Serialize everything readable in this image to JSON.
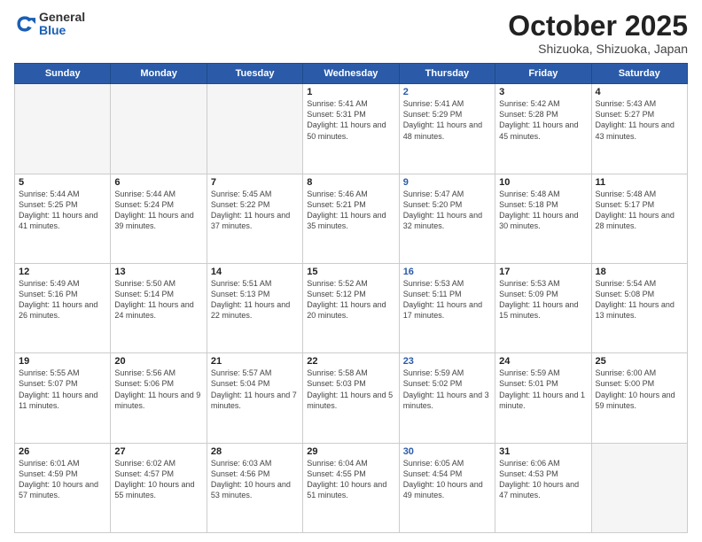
{
  "header": {
    "logo_general": "General",
    "logo_blue": "Blue",
    "month_title": "October 2025",
    "location": "Shizuoka, Shizuoka, Japan"
  },
  "weekdays": [
    "Sunday",
    "Monday",
    "Tuesday",
    "Wednesday",
    "Thursday",
    "Friday",
    "Saturday"
  ],
  "weeks": [
    [
      {
        "day": "",
        "sunrise": "",
        "sunset": "",
        "daylight": "",
        "empty": true
      },
      {
        "day": "",
        "sunrise": "",
        "sunset": "",
        "daylight": "",
        "empty": true
      },
      {
        "day": "",
        "sunrise": "",
        "sunset": "",
        "daylight": "",
        "empty": true
      },
      {
        "day": "1",
        "sunrise": "Sunrise: 5:41 AM",
        "sunset": "Sunset: 5:31 PM",
        "daylight": "Daylight: 11 hours and 50 minutes.",
        "empty": false
      },
      {
        "day": "2",
        "sunrise": "Sunrise: 5:41 AM",
        "sunset": "Sunset: 5:29 PM",
        "daylight": "Daylight: 11 hours and 48 minutes.",
        "empty": false,
        "thursday": true
      },
      {
        "day": "3",
        "sunrise": "Sunrise: 5:42 AM",
        "sunset": "Sunset: 5:28 PM",
        "daylight": "Daylight: 11 hours and 45 minutes.",
        "empty": false
      },
      {
        "day": "4",
        "sunrise": "Sunrise: 5:43 AM",
        "sunset": "Sunset: 5:27 PM",
        "daylight": "Daylight: 11 hours and 43 minutes.",
        "empty": false
      }
    ],
    [
      {
        "day": "5",
        "sunrise": "Sunrise: 5:44 AM",
        "sunset": "Sunset: 5:25 PM",
        "daylight": "Daylight: 11 hours and 41 minutes.",
        "empty": false
      },
      {
        "day": "6",
        "sunrise": "Sunrise: 5:44 AM",
        "sunset": "Sunset: 5:24 PM",
        "daylight": "Daylight: 11 hours and 39 minutes.",
        "empty": false
      },
      {
        "day": "7",
        "sunrise": "Sunrise: 5:45 AM",
        "sunset": "Sunset: 5:22 PM",
        "daylight": "Daylight: 11 hours and 37 minutes.",
        "empty": false
      },
      {
        "day": "8",
        "sunrise": "Sunrise: 5:46 AM",
        "sunset": "Sunset: 5:21 PM",
        "daylight": "Daylight: 11 hours and 35 minutes.",
        "empty": false
      },
      {
        "day": "9",
        "sunrise": "Sunrise: 5:47 AM",
        "sunset": "Sunset: 5:20 PM",
        "daylight": "Daylight: 11 hours and 32 minutes.",
        "empty": false,
        "thursday": true
      },
      {
        "day": "10",
        "sunrise": "Sunrise: 5:48 AM",
        "sunset": "Sunset: 5:18 PM",
        "daylight": "Daylight: 11 hours and 30 minutes.",
        "empty": false
      },
      {
        "day": "11",
        "sunrise": "Sunrise: 5:48 AM",
        "sunset": "Sunset: 5:17 PM",
        "daylight": "Daylight: 11 hours and 28 minutes.",
        "empty": false
      }
    ],
    [
      {
        "day": "12",
        "sunrise": "Sunrise: 5:49 AM",
        "sunset": "Sunset: 5:16 PM",
        "daylight": "Daylight: 11 hours and 26 minutes.",
        "empty": false
      },
      {
        "day": "13",
        "sunrise": "Sunrise: 5:50 AM",
        "sunset": "Sunset: 5:14 PM",
        "daylight": "Daylight: 11 hours and 24 minutes.",
        "empty": false
      },
      {
        "day": "14",
        "sunrise": "Sunrise: 5:51 AM",
        "sunset": "Sunset: 5:13 PM",
        "daylight": "Daylight: 11 hours and 22 minutes.",
        "empty": false
      },
      {
        "day": "15",
        "sunrise": "Sunrise: 5:52 AM",
        "sunset": "Sunset: 5:12 PM",
        "daylight": "Daylight: 11 hours and 20 minutes.",
        "empty": false
      },
      {
        "day": "16",
        "sunrise": "Sunrise: 5:53 AM",
        "sunset": "Sunset: 5:11 PM",
        "daylight": "Daylight: 11 hours and 17 minutes.",
        "empty": false,
        "thursday": true
      },
      {
        "day": "17",
        "sunrise": "Sunrise: 5:53 AM",
        "sunset": "Sunset: 5:09 PM",
        "daylight": "Daylight: 11 hours and 15 minutes.",
        "empty": false
      },
      {
        "day": "18",
        "sunrise": "Sunrise: 5:54 AM",
        "sunset": "Sunset: 5:08 PM",
        "daylight": "Daylight: 11 hours and 13 minutes.",
        "empty": false
      }
    ],
    [
      {
        "day": "19",
        "sunrise": "Sunrise: 5:55 AM",
        "sunset": "Sunset: 5:07 PM",
        "daylight": "Daylight: 11 hours and 11 minutes.",
        "empty": false
      },
      {
        "day": "20",
        "sunrise": "Sunrise: 5:56 AM",
        "sunset": "Sunset: 5:06 PM",
        "daylight": "Daylight: 11 hours and 9 minutes.",
        "empty": false
      },
      {
        "day": "21",
        "sunrise": "Sunrise: 5:57 AM",
        "sunset": "Sunset: 5:04 PM",
        "daylight": "Daylight: 11 hours and 7 minutes.",
        "empty": false
      },
      {
        "day": "22",
        "sunrise": "Sunrise: 5:58 AM",
        "sunset": "Sunset: 5:03 PM",
        "daylight": "Daylight: 11 hours and 5 minutes.",
        "empty": false
      },
      {
        "day": "23",
        "sunrise": "Sunrise: 5:59 AM",
        "sunset": "Sunset: 5:02 PM",
        "daylight": "Daylight: 11 hours and 3 minutes.",
        "empty": false,
        "thursday": true
      },
      {
        "day": "24",
        "sunrise": "Sunrise: 5:59 AM",
        "sunset": "Sunset: 5:01 PM",
        "daylight": "Daylight: 11 hours and 1 minute.",
        "empty": false
      },
      {
        "day": "25",
        "sunrise": "Sunrise: 6:00 AM",
        "sunset": "Sunset: 5:00 PM",
        "daylight": "Daylight: 10 hours and 59 minutes.",
        "empty": false
      }
    ],
    [
      {
        "day": "26",
        "sunrise": "Sunrise: 6:01 AM",
        "sunset": "Sunset: 4:59 PM",
        "daylight": "Daylight: 10 hours and 57 minutes.",
        "empty": false
      },
      {
        "day": "27",
        "sunrise": "Sunrise: 6:02 AM",
        "sunset": "Sunset: 4:57 PM",
        "daylight": "Daylight: 10 hours and 55 minutes.",
        "empty": false
      },
      {
        "day": "28",
        "sunrise": "Sunrise: 6:03 AM",
        "sunset": "Sunset: 4:56 PM",
        "daylight": "Daylight: 10 hours and 53 minutes.",
        "empty": false
      },
      {
        "day": "29",
        "sunrise": "Sunrise: 6:04 AM",
        "sunset": "Sunset: 4:55 PM",
        "daylight": "Daylight: 10 hours and 51 minutes.",
        "empty": false
      },
      {
        "day": "30",
        "sunrise": "Sunrise: 6:05 AM",
        "sunset": "Sunset: 4:54 PM",
        "daylight": "Daylight: 10 hours and 49 minutes.",
        "empty": false,
        "thursday": true
      },
      {
        "day": "31",
        "sunrise": "Sunrise: 6:06 AM",
        "sunset": "Sunset: 4:53 PM",
        "daylight": "Daylight: 10 hours and 47 minutes.",
        "empty": false
      },
      {
        "day": "",
        "sunrise": "",
        "sunset": "",
        "daylight": "",
        "empty": true
      }
    ]
  ]
}
